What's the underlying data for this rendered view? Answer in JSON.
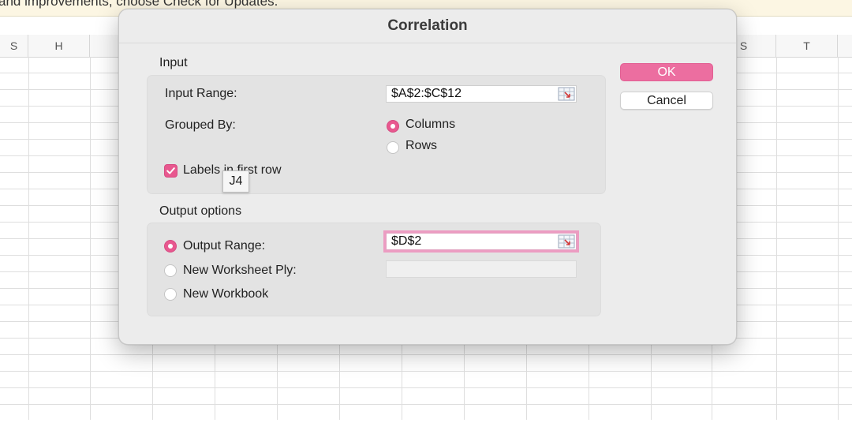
{
  "notice": {
    "text": "and improvements, choose Check for Updates."
  },
  "sheet": {
    "column_headers": [
      "S",
      "H",
      "S",
      "T"
    ]
  },
  "dialog": {
    "title": "Correlation",
    "input": {
      "section_label": "Input",
      "input_range_label": "Input Range:",
      "input_range_value": "$A$2:$C$12",
      "grouped_by_label": "Grouped By:",
      "columns_label": "Columns",
      "rows_label": "Rows",
      "grouped_by_selected": "Columns",
      "labels_checkbox_label": "Labels in first row",
      "labels_checked": true
    },
    "output": {
      "section_label": "Output options",
      "output_range_label": "Output Range:",
      "output_range_value": "$D$2",
      "new_worksheet_label": "New Worksheet Ply:",
      "new_workbook_label": "New Workbook",
      "selected": "Output Range"
    },
    "buttons": {
      "ok": "OK",
      "cancel": "Cancel"
    }
  },
  "tooltip": {
    "text": "J4"
  },
  "colors": {
    "accent": "#e8588f",
    "ok_button": "#ec6ea0"
  },
  "icons": [
    "range-selector-icon",
    "checkmark-icon"
  ]
}
